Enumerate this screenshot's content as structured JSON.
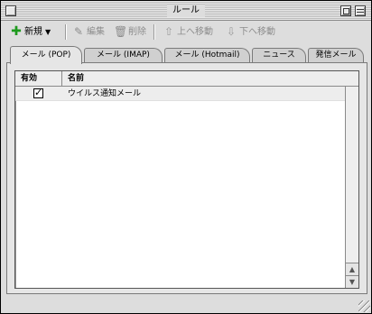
{
  "window": {
    "title": "ルール"
  },
  "toolbar": {
    "new_label": "新規",
    "edit_label": "編集",
    "delete_label": "削除",
    "move_up_label": "上へ移動",
    "move_down_label": "下へ移動"
  },
  "tabs": [
    {
      "label": "メール (POP)",
      "active": true
    },
    {
      "label": "メール (IMAP)",
      "active": false
    },
    {
      "label": "メール (Hotmail)",
      "active": false
    },
    {
      "label": "ニュース",
      "active": false
    },
    {
      "label": "発信メール",
      "active": false
    }
  ],
  "list": {
    "columns": [
      "有効",
      "名前"
    ],
    "rows": [
      {
        "enabled": true,
        "name": "ウイルス通知メール"
      }
    ]
  },
  "icons": {
    "new": "plus-icon",
    "edit": "pencil-icon",
    "delete": "trash-icon",
    "up": "arrow-up-icon",
    "down": "arrow-down-icon"
  },
  "colors": {
    "new_icon": "#1e9a1e",
    "disabled_text": "#8c8c8c"
  }
}
